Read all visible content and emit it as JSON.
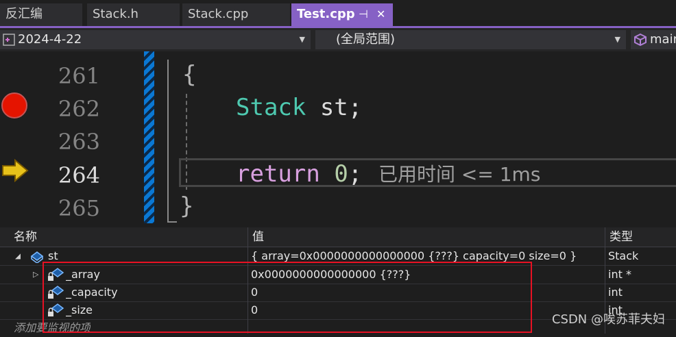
{
  "tabs": [
    {
      "label": "反汇编",
      "active": false
    },
    {
      "label": "Stack.h",
      "active": false
    },
    {
      "label": "Stack.cpp",
      "active": false
    },
    {
      "label": "Test.cpp",
      "active": true
    }
  ],
  "tab_pin_glyph": "⊣",
  "tab_close_glyph": "✕",
  "navbar": {
    "project": "2024-4-22",
    "scope": "(全局范围)",
    "member": "main"
  },
  "editor": {
    "line_numbers": [
      "261",
      "262",
      "263",
      "264",
      "265"
    ],
    "current_line": "264",
    "code": {
      "open_brace": "{",
      "type": "Stack",
      "var": " st;",
      "keyword": "return",
      "number": "0",
      "semicolon": ";",
      "close_brace": "}"
    },
    "perf_tip": "已用时间 <= 1ms"
  },
  "watch": {
    "columns": {
      "name": "名称",
      "value": "值",
      "type": "类型"
    },
    "rows": [
      {
        "name": "st",
        "value": "{ array=0x0000000000000000 {???}  capacity=0  size=0 }",
        "type": "Stack"
      },
      {
        "name": "_array",
        "value": "0x0000000000000000 {???}",
        "type": "int *"
      },
      {
        "name": "_capacity",
        "value": "0",
        "type": "int"
      },
      {
        "name": "_size",
        "value": "0",
        "type": "int"
      }
    ],
    "add_watch_placeholder": "添加要监视的项"
  },
  "watermark": "CSDN @唉苏菲夫妇",
  "colors": {
    "accent": "#8661c5",
    "keyword": "#d8a0df",
    "type": "#4ec9b0",
    "number": "#b5cea8",
    "breakpoint": "#e51400",
    "highlight_box": "#e81123"
  }
}
